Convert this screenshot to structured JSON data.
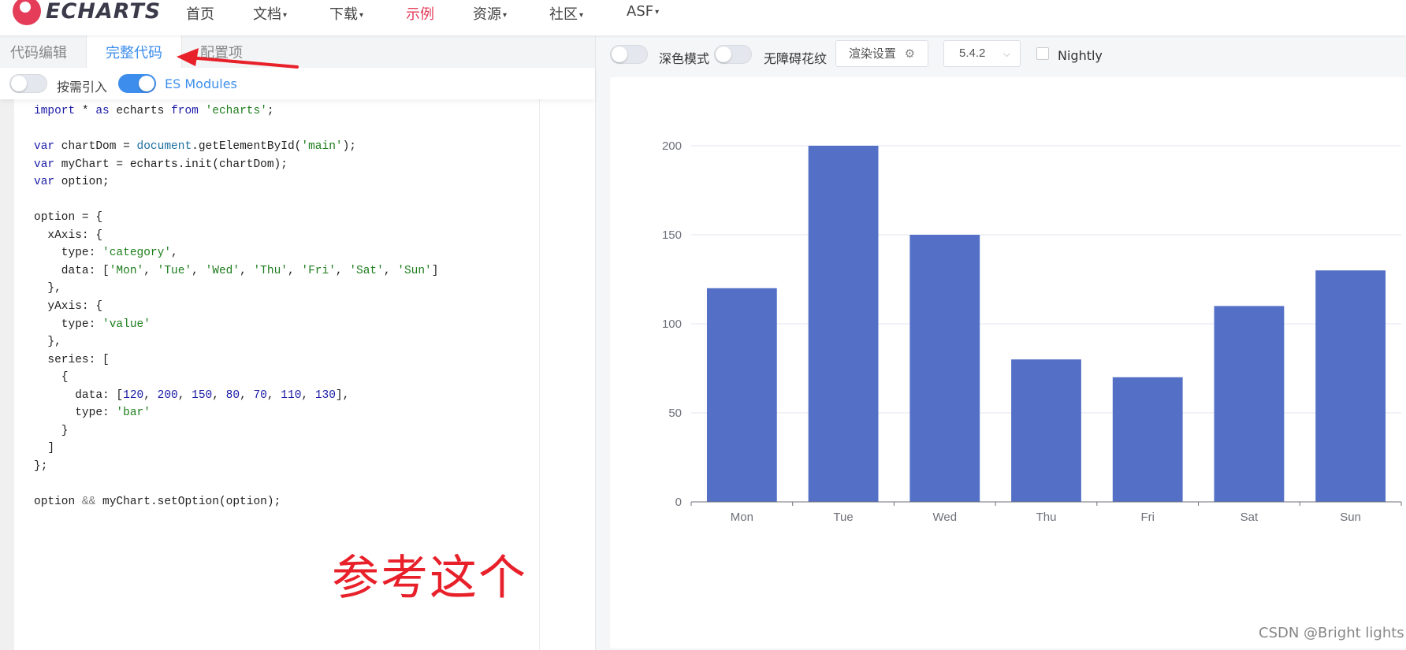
{
  "nav": {
    "logo_text": "ECHARTS",
    "items": [
      {
        "label": "首页",
        "dropdown": false
      },
      {
        "label": "文档",
        "dropdown": true
      },
      {
        "label": "下载",
        "dropdown": true
      },
      {
        "label": "示例",
        "dropdown": false,
        "active": true
      },
      {
        "label": "资源",
        "dropdown": true
      },
      {
        "label": "社区",
        "dropdown": true
      },
      {
        "label": "ASF",
        "dropdown": true
      }
    ]
  },
  "editor": {
    "tabs": [
      "代码编辑",
      "完整代码",
      "配置项"
    ],
    "active_tab": "完整代码",
    "options": {
      "on_demand_label": "按需引入",
      "on_demand": false,
      "es_modules_label": "ES Modules",
      "es_modules": true
    },
    "code_lines": [
      "import * as echarts from 'echarts';",
      "",
      "var chartDom = document.getElementById('main');",
      "var myChart = echarts.init(chartDom);",
      "var option;",
      "",
      "option = {",
      "  xAxis: {",
      "    type: 'category',",
      "    data: ['Mon', 'Tue', 'Wed', 'Thu', 'Fri', 'Sat', 'Sun']",
      "  },",
      "  yAxis: {",
      "    type: 'value'",
      "  },",
      "  series: [",
      "    {",
      "      data: [120, 200, 150, 80, 70, 110, 130],",
      "      type: 'bar'",
      "    }",
      "  ]",
      "};",
      "",
      "option && myChart.setOption(option);"
    ],
    "annotation": "参考这个"
  },
  "toolbar": {
    "dark_mode_label": "深色模式",
    "dark_mode": false,
    "accessibility_label": "无障碍花纹",
    "accessibility": false,
    "render_settings_label": "渲染设置",
    "version": "5.4.2",
    "nightly_label": "Nightly",
    "nightly": false
  },
  "chart_data": {
    "type": "bar",
    "categories": [
      "Mon",
      "Tue",
      "Wed",
      "Thu",
      "Fri",
      "Sat",
      "Sun"
    ],
    "values": [
      120,
      200,
      150,
      80,
      70,
      110,
      130
    ],
    "ylim": [
      0,
      200
    ],
    "yticks": [
      0,
      50,
      100,
      150,
      200
    ],
    "bar_color": "#5470c6",
    "grid": true
  },
  "watermark": "CSDN @Bright lights",
  "colors": {
    "brand": "#e43c59",
    "accent": "#3d8eec",
    "arrow": "#e8202a"
  }
}
